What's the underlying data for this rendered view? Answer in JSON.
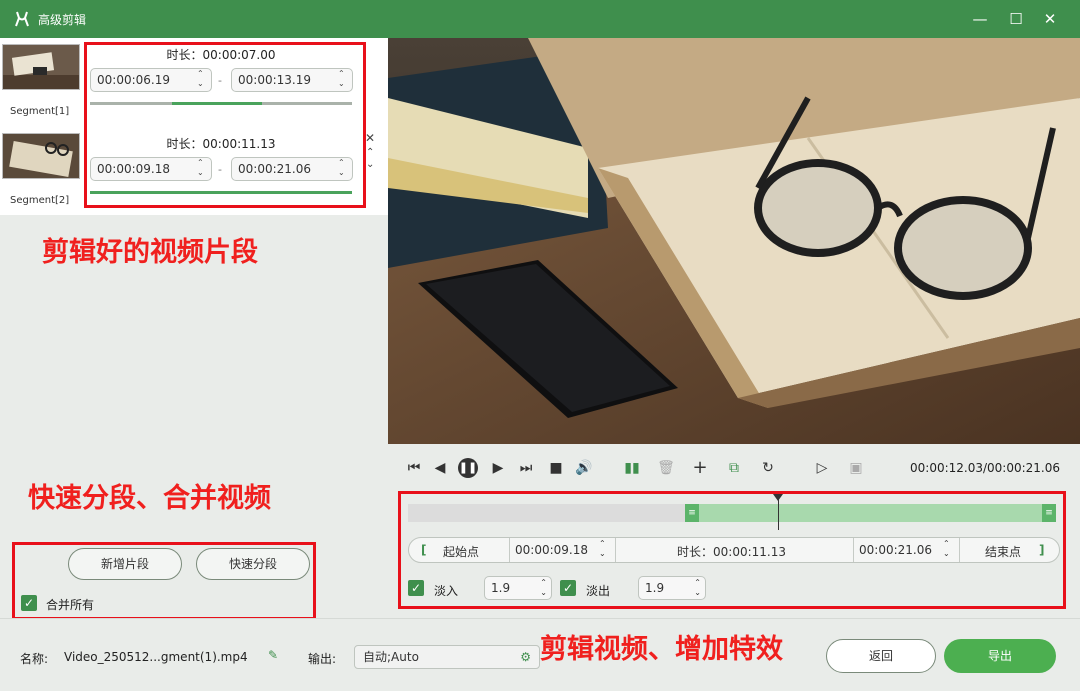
{
  "window": {
    "title": "高级剪辑"
  },
  "segments": [
    {
      "label": "Segment[1]",
      "duration": "时长：00:00:07.00",
      "start": "00:00:06.19",
      "end": "00:00:13.19",
      "dash": "-"
    },
    {
      "label": "Segment[2]",
      "duration": "时长：00:00:11.13",
      "start": "00:00:09.18",
      "end": "00:00:21.06",
      "dash": "-"
    }
  ],
  "annotations": {
    "clips": "剪辑好的视频片段",
    "split": "快速分段、合并视频",
    "edit": "剪辑视频、增加特效"
  },
  "left_buttons": {
    "new_segment": "新增片段",
    "quick_split": "快速分段",
    "merge_all": "合并所有"
  },
  "player": {
    "timecode": "00:00:12.03/00:00:21.06",
    "progress_fraction": 0.571
  },
  "trim": {
    "start_label": "起始点",
    "start_value": "00:00:09.18",
    "duration": "时长：00:00:11.13",
    "end_value": "00:00:21.06",
    "end_label": "结束点",
    "bracket_left": "[",
    "bracket_right": "]",
    "selection_start_fraction": 0.437,
    "selection_end_fraction": 1.0
  },
  "effects": {
    "fade_in_label": "淡入",
    "fade_in_value": "1.9",
    "fade_out_label": "淡出",
    "fade_out_value": "1.9"
  },
  "bottom": {
    "name_label": "名称:",
    "name_value": "Video_250512...gment(1).mp4",
    "output_label": "输出:",
    "output_value": "自动;Auto",
    "back_button": "返回",
    "export_button": "导出"
  },
  "colors": {
    "brand_green": "#3f8f4d",
    "annotation_red": "#e8101a"
  }
}
